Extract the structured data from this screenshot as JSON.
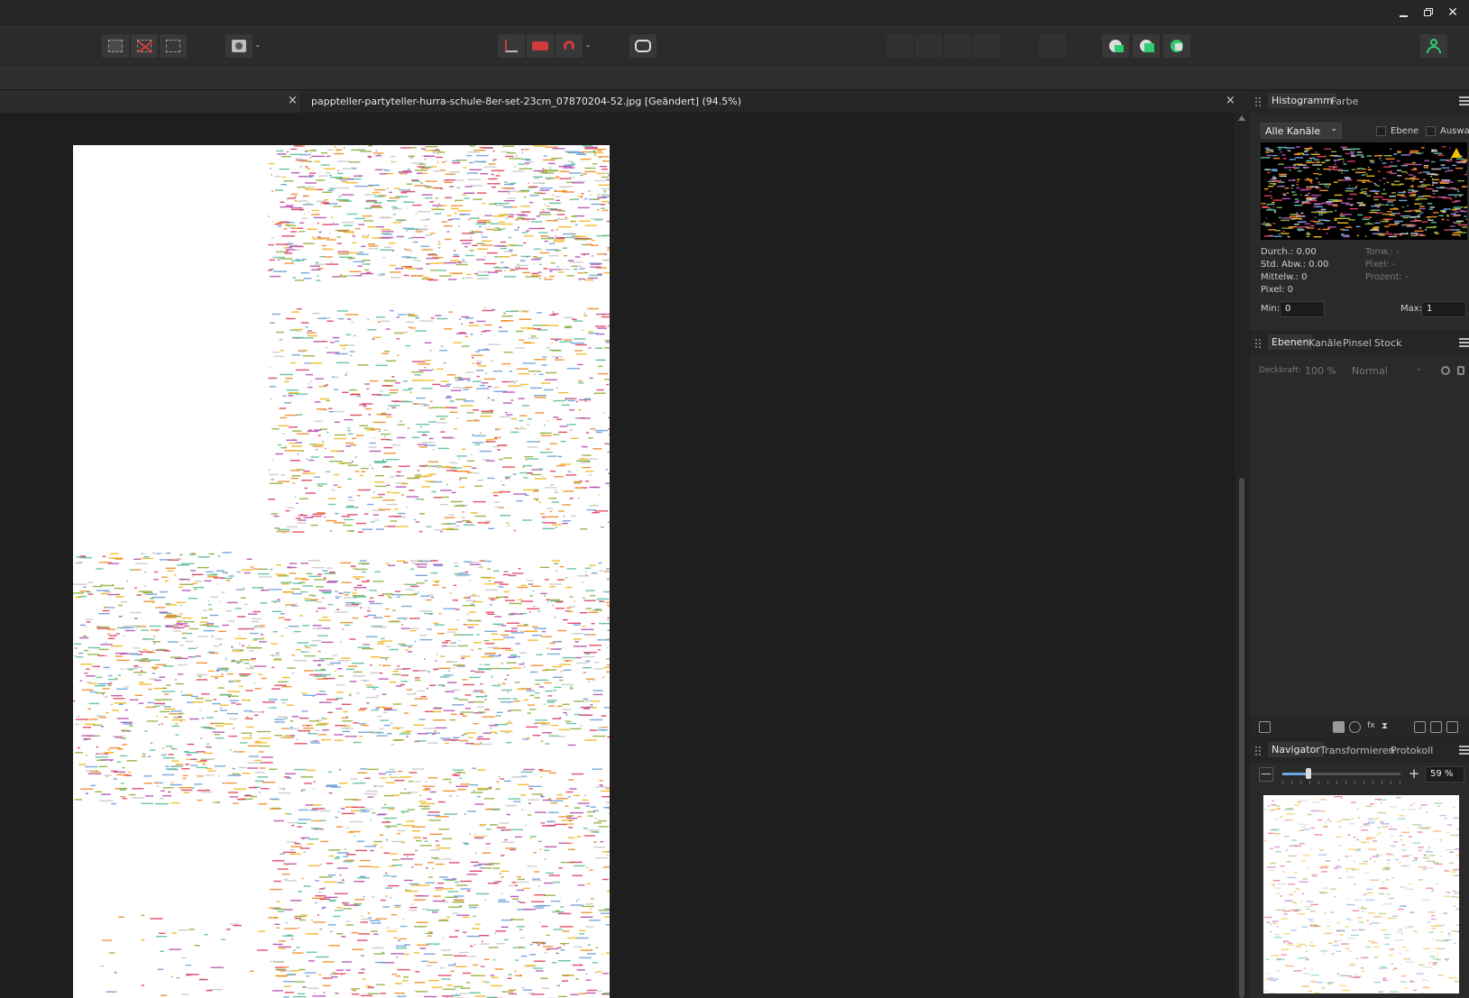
{
  "window": {
    "minimize_icon": "minimize-icon",
    "restore_icon": "restore-icon",
    "close_icon": "close-icon"
  },
  "toolbar": {
    "groups": [
      [
        "select-all-icon",
        "deselect-icon",
        "invert-selection-icon"
      ],
      [
        "quick-mask-icon"
      ],
      [
        "snapping-icon",
        "assistant-icon",
        "red-eye-icon"
      ],
      [
        "personas-icon"
      ],
      [
        "arrange-front-icon",
        "arrange-forward-icon",
        "arrange-backward-icon",
        "arrange-back-icon"
      ],
      [
        "align-icon"
      ],
      [
        "boolean-add-icon",
        "boolean-subtract-icon",
        "boolean-intersect-icon"
      ],
      [
        "user-account-icon"
      ]
    ],
    "accent": "#2ecc71"
  },
  "document": {
    "tab_title": "pappteller-partyteller-hurra-schule-8er-set-23cm_07870204-52.jpg [Geändert] (94.5%)",
    "close_symbol": "×"
  },
  "histogram_panel": {
    "tabs": [
      "Histogramm",
      "Farbe"
    ],
    "channel_select": "Alle Kanäle",
    "checkboxes": [
      "Ebene",
      "Auswahl"
    ],
    "stats_left": [
      "Durch.: 0.00",
      "Std. Abw.: 0.00",
      "Mittelw.: 0",
      "Pixel: 0"
    ],
    "stats_right": [
      "Tonw.: -",
      "Pixel: -",
      "Prozent: -"
    ],
    "min_label": "Min:",
    "min_value": "0",
    "max_label": "Max:",
    "max_value": "1",
    "warning_icon": "warning-icon"
  },
  "layers_panel": {
    "tabs": [
      "Ebenen",
      "Kanäle",
      "Pinsel",
      "Stock"
    ],
    "opacity_label": "Deckkraft:",
    "opacity_value": "100 %",
    "blend_mode": "Normal",
    "bottom_icons": [
      "mask-icon",
      "adjustment-icon",
      "fx-icon",
      "live-filter-icon",
      "group-icon",
      "add-pixel-layer-icon",
      "delete-icon"
    ]
  },
  "navigator_panel": {
    "tabs": [
      "Navigator",
      "Transformieren",
      "Protokoll"
    ],
    "minus": "—",
    "plus": "+",
    "zoom": "59 %",
    "zoom_level": 0.22
  },
  "colors": {
    "accent_blue": "#6fa7e0",
    "accent_green": "#2ecc71",
    "warning": "#f2c200"
  }
}
